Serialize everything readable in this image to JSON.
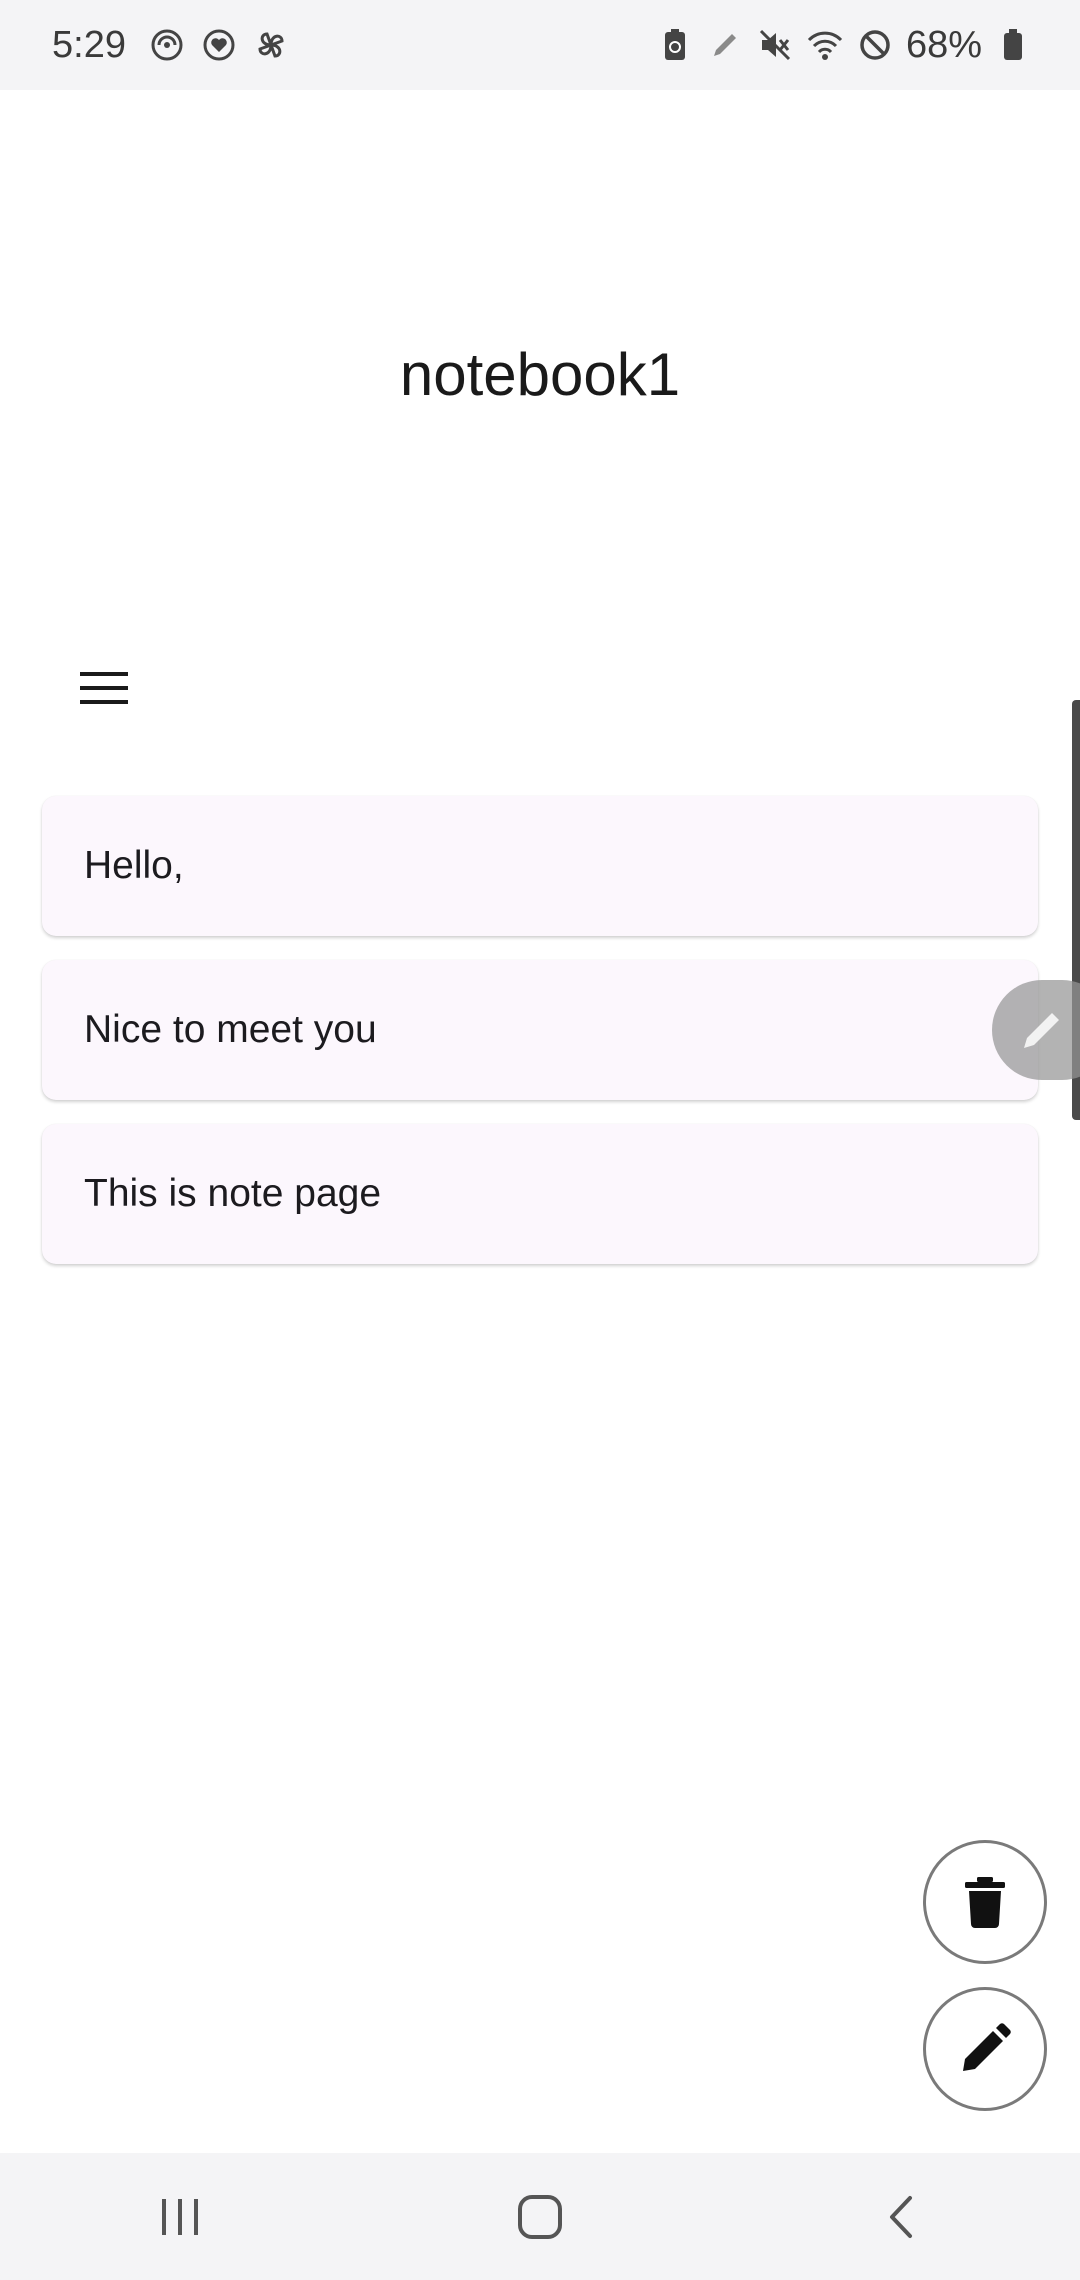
{
  "status_bar": {
    "time": "5:29",
    "battery_percent": "68%",
    "left_icons": [
      "focus-icon",
      "heart-app-icon",
      "pinwheel-icon"
    ],
    "right_icons": [
      "battery-saver-icon",
      "pen-icon",
      "mute-icon",
      "wifi-icon",
      "do-not-disturb-icon",
      "battery-icon"
    ]
  },
  "page": {
    "title": "notebook1",
    "menu_icon": "hamburger-menu-icon"
  },
  "notes": [
    {
      "text": "Hello,"
    },
    {
      "text": "Nice to meet you"
    },
    {
      "text": "This is note page"
    }
  ],
  "fabs": {
    "delete_icon": "trash-icon",
    "edit_icon": "pencil-icon"
  },
  "edge_panel": {
    "icon": "pencil-icon"
  },
  "nav_bar": {
    "recents_icon": "recents-icon",
    "home_icon": "home-icon",
    "back_icon": "back-icon"
  },
  "colors": {
    "card_background": "#fcf7fd",
    "status_bar_background": "#f4f4f6",
    "fab_border": "#7a7a7a"
  }
}
